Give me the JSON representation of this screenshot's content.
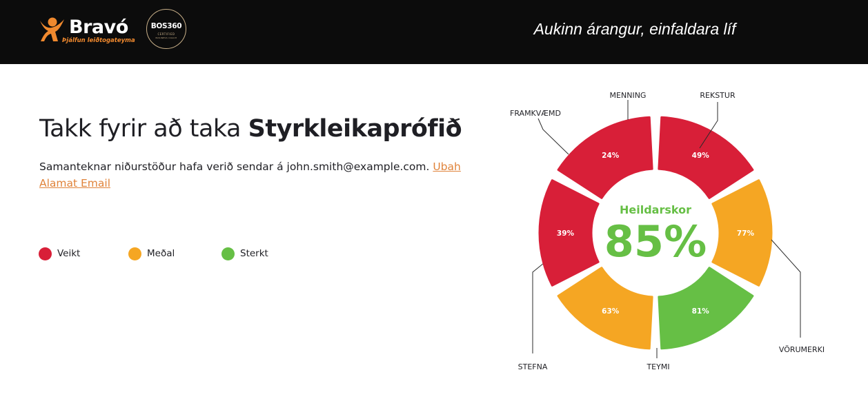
{
  "header": {
    "logo_name": "Bravó",
    "logo_tagline": "Þjálfun leiðtogateyma",
    "badge_name": "BOS360",
    "badge_sub": "CERTIFIED",
    "badge_sub2": "BUSINESS COACH",
    "slogan": "Aukinn árangur, einfaldara líf"
  },
  "main": {
    "title_prefix": "Takk fyrir að taka ",
    "title_bold": "Styrkleikaprófið",
    "summary_text": "Samanteknar niðurstöður hafa verið sendar á  john.smith@example.com. ",
    "summary_link": "Ubah Alamat Email"
  },
  "legend": [
    {
      "label": "Veikt",
      "color": "#d81f38"
    },
    {
      "label": "Meðal",
      "color": "#f5a623"
    },
    {
      "label": "Sterkt",
      "color": "#66bf45"
    }
  ],
  "colors": {
    "weak": "#d81f38",
    "medium": "#f5a623",
    "strong": "#66bf45"
  },
  "chart_data": {
    "type": "pie",
    "style": "donut",
    "center_label": "Heildarskor",
    "center_value": "85%",
    "segments": [
      {
        "name": "REKSTUR",
        "value": 49,
        "label": "49%",
        "level": "weak"
      },
      {
        "name": "VÖRUMERKI",
        "value": 77,
        "label": "77%",
        "level": "medium"
      },
      {
        "name": "TEYMI",
        "value": 81,
        "label": "81%",
        "level": "strong"
      },
      {
        "name": "STEFNA",
        "value": 63,
        "label": "63%",
        "level": "medium"
      },
      {
        "name": "FRAMKVÆMD",
        "value": 39,
        "label": "39%",
        "level": "weak"
      },
      {
        "name": "MENNING",
        "value": 24,
        "label": "24%",
        "level": "weak"
      }
    ]
  }
}
